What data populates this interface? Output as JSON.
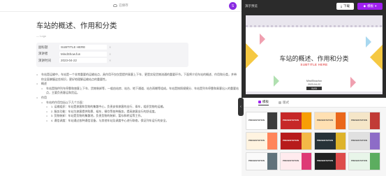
{
  "editor": {
    "save_status": "已保存",
    "avatar_letter": "S",
    "title": "车站的概述、作用和分类",
    "logo_label": "Logo",
    "meta": [
      {
        "key": "副标题",
        "value": "SUBTITLE HERE"
      },
      {
        "key": "演讲者",
        "value": "MindShow.fun"
      },
      {
        "key": "演讲时间",
        "value": "2023-04-22"
      }
    ],
    "outline": [
      {
        "level": 1,
        "text": "车站是运输中，车站是一个非常重要的运输站点，具作用不仅仅是提供乘客上下车、更是实现货物流通的重要环节。下面将介绍车站的概述、作用和分类，并带你全面掌握这些知识，更好地理解运输站点的重要性。"
      },
      {
        "level": 1,
        "text": "概述"
      },
      {
        "level": 2,
        "text": "车站是指供列车停靠和旅客上下车、货物装卸等，一般由站房、站台、地下通道、站台雨棚等组成。车站是按照规模分、车站是列车停靠和乘客出入的重要站点，主要负责客运和货运。"
      },
      {
        "level": 1,
        "text": "作用"
      },
      {
        "level": 2,
        "text": "车站的作用包括以下几个方面："
      },
      {
        "level": 3,
        "text": "1. 运输组织：车站是旅客和货物的集散中心，负责安排旅客的出行、乘车，组织货物的运输。"
      },
      {
        "level": 3,
        "text": "2. 服务功能：车站为旅客提供购票、候车、餐饮等各种服务，提高旅客出行的舒适度。"
      },
      {
        "level": 3,
        "text": "3. 货物装卸：车站是货物的集散地，负责货物的装卸、暂存和转运等工作。"
      },
      {
        "level": 3,
        "text": "4. 通信调度：车站通过各种通信设备，与其他车站及调度中心进行联络，保证列车运行的安全。"
      }
    ]
  },
  "preview": {
    "label": "演示预览",
    "download_label": "下载",
    "template_label": "模板",
    "slide": {
      "title": "车站的概述、作用和分类",
      "subtitle": "SUBTITLE HERE",
      "author": "MindShow.fun",
      "date": "2023-04-22",
      "badge": "01/05"
    },
    "tabs": {
      "template_tab": "模板",
      "layout_tab": "版式"
    },
    "thumbnails": [
      {
        "title": "PRESENTATION",
        "bg": "#ffffff",
        "accent": "#1a1a1a",
        "light": true
      },
      {
        "title": "PRESENTATION",
        "bg": "#c62828",
        "accent": "#ffb300",
        "light": false
      },
      {
        "title": "PRESENTATION",
        "bg": "#ffe0b2",
        "accent": "#e65100",
        "light": true
      },
      {
        "title": "PRESENTATION",
        "bg": "#f5e6c8",
        "accent": "#b71c1c",
        "light": true
      },
      {
        "title": "PRESENTATION",
        "bg": "#fff3e0",
        "accent": "#ff7043",
        "light": true
      },
      {
        "title": "PRESENTATION",
        "bg": "#b71c1c",
        "accent": "#ffd54f",
        "light": false
      },
      {
        "title": "PRESENTATION",
        "bg": "#263238",
        "accent": "#ffca28",
        "light": false
      },
      {
        "title": "PRESENTATION",
        "bg": "#e0e0e0",
        "accent": "#7e57c2",
        "light": true
      },
      {
        "title": "PRESENTATION",
        "bg": "#fafafa",
        "accent": "#455a64",
        "light": true
      },
      {
        "title": "PRESENTATION",
        "bg": "#ffebee",
        "accent": "#d81b60",
        "light": true
      },
      {
        "title": "PRESENTATION",
        "bg": "#212121",
        "accent": "#ff5252",
        "light": false
      },
      {
        "title": "PRESENTATION",
        "bg": "#e8f5e9",
        "accent": "#43a047",
        "light": true
      }
    ]
  },
  "colors": {
    "accent": "#a020f0",
    "preview_bg": "#2b2b2b",
    "subtitle_red": "#dd2222"
  }
}
